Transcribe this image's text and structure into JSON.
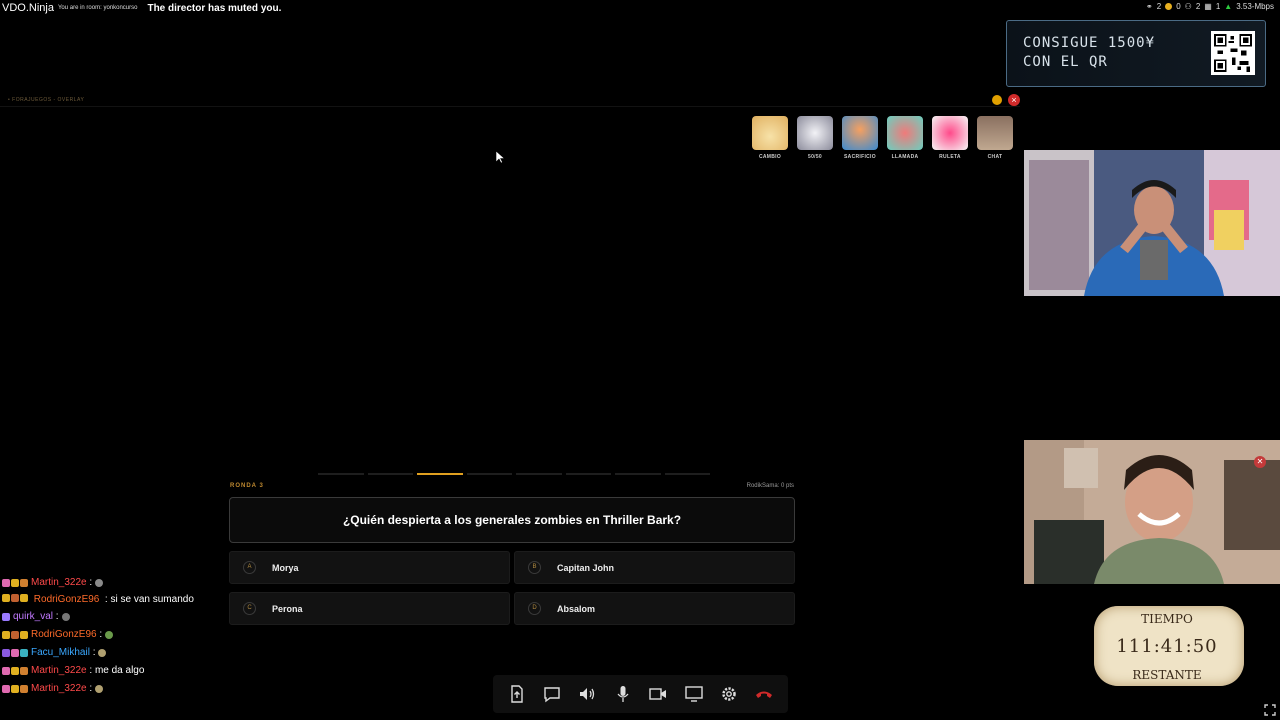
{
  "topbar": {
    "brand": "VDO.Ninja",
    "room": "You are in room: yonkoncurso",
    "muted": "The director has muted you.",
    "stats": [
      "2",
      "0",
      "2",
      "1",
      "3.53-Mbps"
    ]
  },
  "promo": {
    "line1": "CONSIGUE 1500¥",
    "line2": "CON EL QR"
  },
  "overlay": {
    "label": "• FORAJUEGOS - OVERLAY"
  },
  "powerups": [
    {
      "label": "CAMBIO",
      "icon": "swap-hands-icon",
      "color": "#f0d27a"
    },
    {
      "label": "50/50",
      "icon": "fifty-fifty-icon",
      "color": "#d9d9e3"
    },
    {
      "label": "SACRIFICIO",
      "icon": "sacrifice-icon",
      "color": "#f08a3a"
    },
    {
      "label": "LLAMADA",
      "icon": "phone-call-icon",
      "color": "#7fd0c0"
    },
    {
      "label": "RULETA",
      "icon": "roulette-icon",
      "color": "#f2f2f2"
    },
    {
      "label": "CHAT",
      "icon": "chat-icon",
      "color": "#b59a86"
    }
  ],
  "quiz": {
    "round": "RONDA 3",
    "score": "RodikSama: 0 pts",
    "question": "¿Quién despierta a los generales zombies en Thriller Bark?",
    "progress_total": 8,
    "progress_current": 2,
    "answers": [
      {
        "letter": "A",
        "text": "Morya"
      },
      {
        "letter": "B",
        "text": "Capitan John"
      },
      {
        "letter": "C",
        "text": "Perona"
      },
      {
        "letter": "D",
        "text": "Absalom"
      }
    ]
  },
  "chat": [
    {
      "user": "Martin_322e",
      "color": "#ff4a4a",
      "msg": "",
      "icon": "#8a8a8a"
    },
    {
      "user": "RodriGonzE96",
      "color": "#ff6b2a",
      "msg": "si se van sumando",
      "icon": ""
    },
    {
      "user": "quirk_val",
      "color": "#c27aff",
      "msg": "",
      "icon": "#777"
    },
    {
      "user": "RodriGonzE96",
      "color": "#ff6b2a",
      "msg": "",
      "icon": "#6a9a4a"
    },
    {
      "user": "Facu_Mikhail",
      "color": "#3aa8ff",
      "msg": "",
      "icon": "#b0a070"
    },
    {
      "user": "Martin_322e",
      "color": "#ff4a4a",
      "msg": "me da algo",
      "icon": ""
    },
    {
      "user": "Martin_322e",
      "color": "#ff4a4a",
      "msg": "",
      "icon": "#b0a070"
    }
  ],
  "timer": {
    "line1": "TIEMPO",
    "time": "111:41:50",
    "line3": "RESTANTE"
  },
  "toolbar": [
    "share-file-icon",
    "chat-icon",
    "speaker-icon",
    "microphone-icon",
    "camera-icon",
    "screen-share-icon",
    "settings-icon",
    "hangup-icon"
  ],
  "colors": {
    "accent": "#e0a020",
    "brand": "#4b6b85",
    "hangup": "#d02a2a"
  }
}
